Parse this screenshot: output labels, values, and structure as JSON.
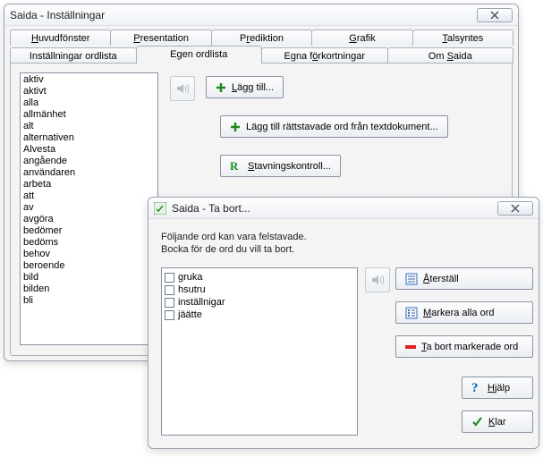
{
  "settings": {
    "title": "Saida - Inställningar",
    "close_aria": "Close",
    "tabs_row1": {
      "t0": "Huvudfönster",
      "t1": "Presentation",
      "t2": "Prediktion",
      "t3": "Grafik",
      "t4": "Talsyntes"
    },
    "tabs_row2": {
      "t0": "Inställningar ordlista",
      "t1": "Egen ordlista",
      "t2": "Egna förkortningar",
      "t3": "Om Saida"
    },
    "active_tab": "Egen ordlista",
    "wordlist": [
      "aktiv",
      "aktivt",
      "alla",
      "allmänhet",
      "alt",
      "alternativen",
      "Alvesta",
      "angående",
      "användaren",
      "arbeta",
      "att",
      "av",
      "avgöra",
      "bedömer",
      "bedöms",
      "behov",
      "beroende",
      "bild",
      "bilden",
      "bli"
    ],
    "buttons": {
      "add": "Lägg till...",
      "add_from_doc": "Lägg till rättstavade ord från textdokument...",
      "spellcheck": "Stavningskontroll..."
    }
  },
  "remove": {
    "title": "Saida - Ta bort...",
    "close_aria": "Close",
    "instr1": "Följande ord kan vara felstavade.",
    "instr2": "Bocka för de ord du vill ta bort.",
    "words": [
      "gruka",
      "hsutru",
      "inställnigar",
      "jäätte"
    ],
    "buttons": {
      "reset": "Återställ",
      "mark_all": "Markera alla ord",
      "remove_marked": "Ta bort markerade ord",
      "help": "Hjälp",
      "done": "Klar"
    }
  },
  "icons": {
    "close": "close-icon",
    "speaker": "speaker-icon",
    "plus": "plus-icon",
    "r": "spellcheck-r-icon",
    "list": "list-icon",
    "minus": "minus-icon",
    "question": "question-icon",
    "check": "check-icon",
    "app": "saida-app-icon"
  }
}
